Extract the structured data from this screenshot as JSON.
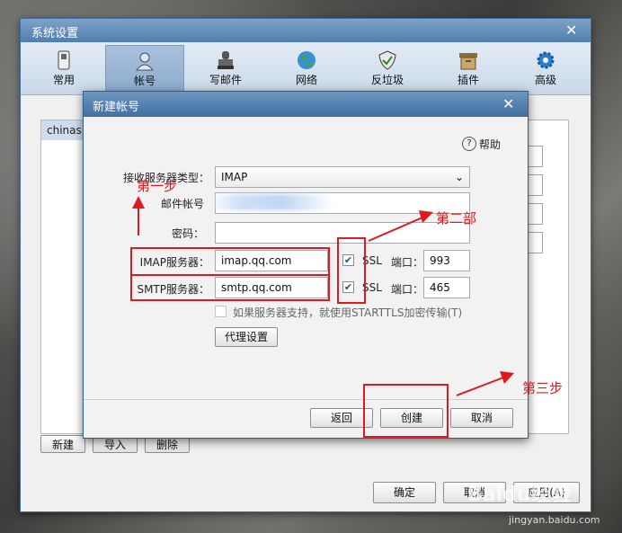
{
  "settings_window": {
    "title": "系统设置",
    "toolbar": [
      {
        "label": "常用",
        "icon": "phone-icon"
      },
      {
        "label": "帐号",
        "icon": "user-icon"
      },
      {
        "label": "写邮件",
        "icon": "stamp-icon"
      },
      {
        "label": "网络",
        "icon": "globe-icon"
      },
      {
        "label": "反垃圾",
        "icon": "shield-icon"
      },
      {
        "label": "插件",
        "icon": "box-icon"
      },
      {
        "label": "高级",
        "icon": "gear-icon"
      }
    ],
    "account_list_item": "chinas",
    "buttons": {
      "new": "新建",
      "import": "导入",
      "delete": "删除"
    },
    "footer": {
      "ok": "确定",
      "cancel": "取消",
      "apply": "应用(A)"
    }
  },
  "dialog": {
    "title": "新建帐号",
    "help": "帮助",
    "server_type_label": "接收服务器类型：",
    "server_type_value": "IMAP",
    "email_label": "邮件帐号",
    "password_label": "密码：",
    "imap_label": "IMAP服务器：",
    "imap_value": "imap.qq.com",
    "smtp_label": "SMTP服务器：",
    "smtp_value": "smtp.qq.com",
    "ssl_label": "SSL",
    "port_label": "端口：",
    "imap_port": "993",
    "smtp_port": "465",
    "starttls_label": "如果服务器支持，就使用STARTTLS加密传输(T)",
    "proxy_button": "代理设置",
    "back_button": "返回",
    "create_button": "创建",
    "cancel_button": "取消"
  },
  "annotations": {
    "step1": "第一步",
    "step2": "第二部",
    "step3": "第三步"
  },
  "watermark": {
    "text": "Baidu经验",
    "url": "jingyan.baidu.com"
  },
  "colors": {
    "annotation_red": "#e0191f",
    "title_blue": "#4f7eae"
  }
}
